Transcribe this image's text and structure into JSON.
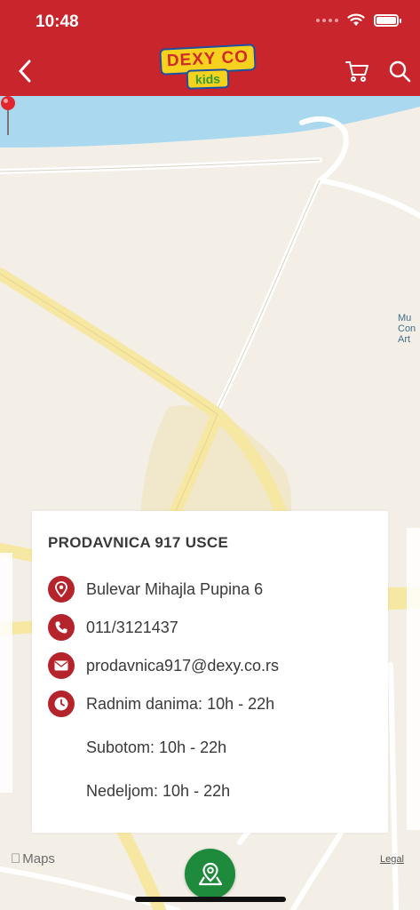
{
  "status_bar": {
    "time": "10:48"
  },
  "header": {
    "logo_top": "DEXY CO",
    "logo_bottom": "kids"
  },
  "map": {
    "label_art": "Mu\nCon\nArt",
    "attribution": "Maps",
    "legal": "Legal"
  },
  "store": {
    "title": "PRODAVNICA 917 USCE",
    "address": "Bulevar Mihajla Pupina 6",
    "phone": "011/3121437",
    "email": "prodavnica917@dexy.co.rs",
    "hours": {
      "weekdays": "Radnim danima: 10h - 22h",
      "saturday": "Subotom: 10h - 22h",
      "sunday": "Nedeljom: 10h - 22h"
    }
  },
  "colors": {
    "header": "#c8252c",
    "icon_circle": "#b5232b",
    "fab": "#1e8a3c",
    "map_bg": "#f3efe6",
    "water": "#a9d8ef"
  },
  "icons": [
    "back-icon",
    "cart-icon",
    "search-icon",
    "location-icon",
    "phone-icon",
    "mail-icon",
    "clock-icon",
    "map-pin-icon"
  ]
}
